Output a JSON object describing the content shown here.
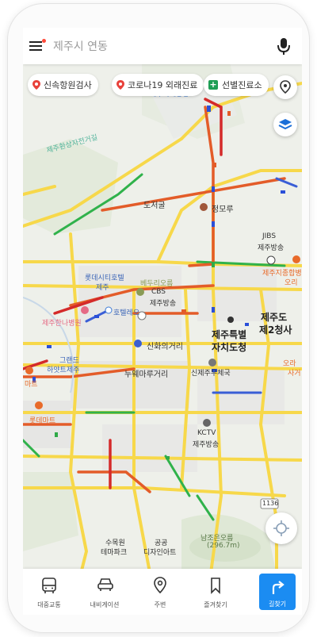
{
  "search": {
    "query": "제주시 연동"
  },
  "chips": [
    {
      "label": "신속항원검사",
      "icon": "red-pin-icon"
    },
    {
      "label": "코로나19 외래진료",
      "icon": "red-pin-icon"
    },
    {
      "label": "선별진료소",
      "icon": "green-plus-icon"
    }
  ],
  "map_labels": {
    "jeju_station_area": "제주국제공항",
    "bike_road": "제주환상자전거길",
    "dojeolgul": "도저굴",
    "jeongmoru": "정모루",
    "jibs": "JIBS",
    "jibs2": "제주방송",
    "jeju_hospital": "제주지종합병",
    "jeju_hospital2": "오리",
    "lotte_hotel": "롯데시티호텔",
    "lotte_hotel2": "제주",
    "bedurioreum": "베두리오름",
    "cbs": "CBS",
    "cbs2": "제주방송",
    "jeju_hanna": "제주한나병원",
    "hotel_leo": "호텔레오",
    "jejudo_office": "제주도",
    "jejudo_office2": "제2청사",
    "jeju_gov": "제주특별",
    "jeju_gov2": "자치도청",
    "shinhwa": "신화의거리",
    "grand_hyatt": "그랜드",
    "grand_hyatt2": "하얏트제주",
    "nuwemaru": "누웨마루거리",
    "shinjeju": "신제주우체국",
    "mart_side": "마트",
    "ora": "오라",
    "ora2": "사거",
    "lotte_mart": "롯데마트",
    "kctv": "KCTV",
    "kctv2": "제주방송",
    "road_1136": "1136",
    "namjoeun": "남조은오름",
    "namjoeun_h": "(296.7m)",
    "sumokwon": "수목원",
    "sumokwon2": "테마파크",
    "gonggong": "공공",
    "gonggong2": "디자인아트",
    "airport_area": "제주국제공항"
  },
  "bottom_nav": [
    {
      "label": "대중교통",
      "icon": "bus-icon"
    },
    {
      "label": "내비게이션",
      "icon": "car-icon"
    },
    {
      "label": "주변",
      "icon": "location-pin-icon"
    },
    {
      "label": "즐겨찾기",
      "icon": "bookmark-icon"
    },
    {
      "label": "길찾기",
      "icon": "directions-arrow-icon"
    }
  ],
  "colors": {
    "traffic_smooth": "#30b24b",
    "traffic_slow": "#f1a61b",
    "traffic_heavy": "#e35c29",
    "traffic_jam": "#d42a2a",
    "road_main": "#f7d84a",
    "accent_blue": "#1b8cf2",
    "chip_pin_red": "#e8413a",
    "chip_plus_green": "#1e9e55"
  }
}
